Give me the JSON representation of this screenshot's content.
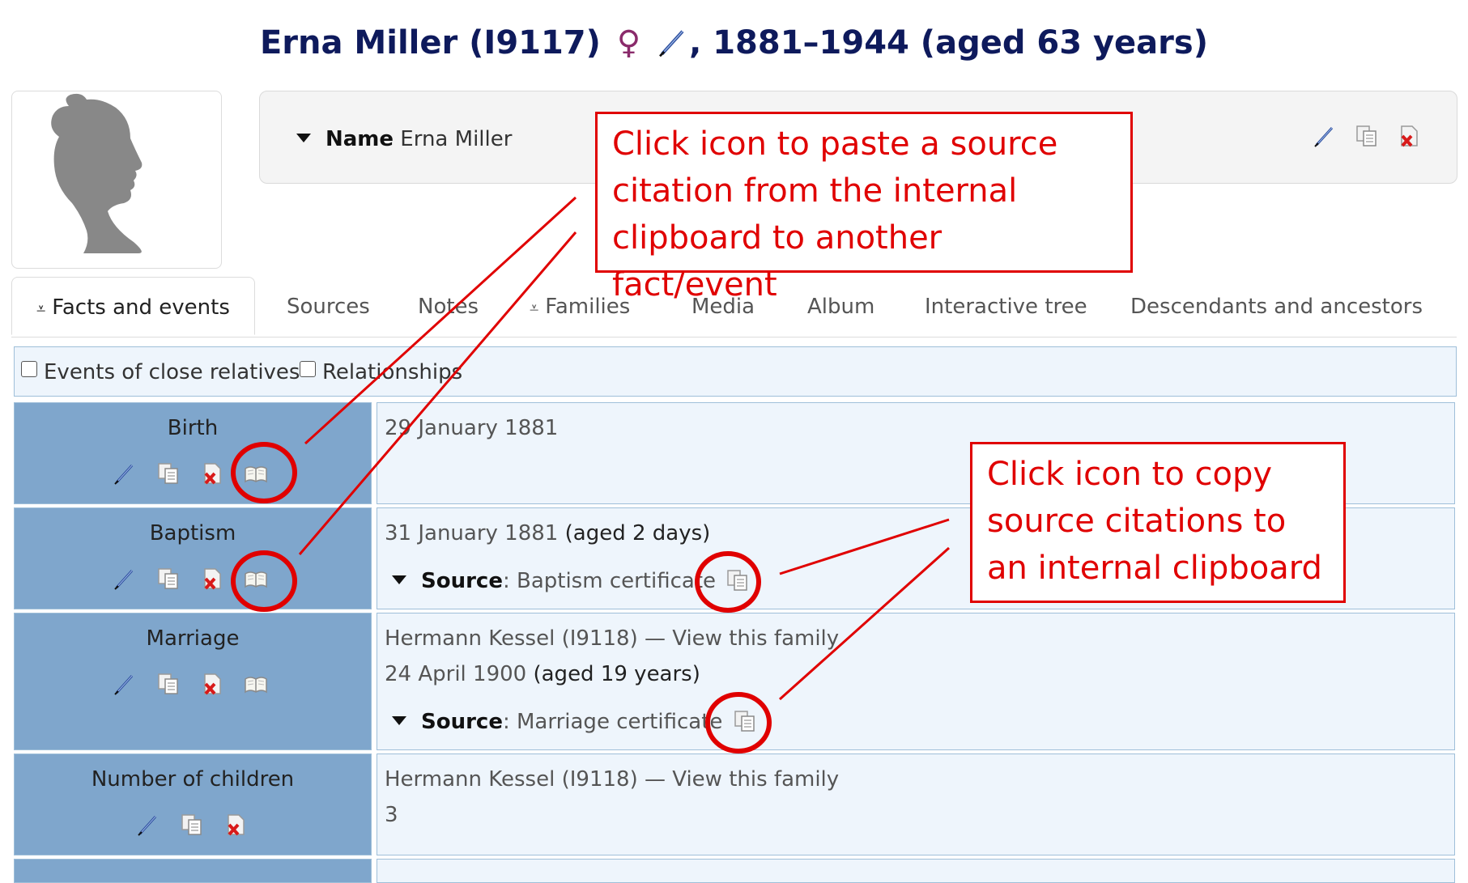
{
  "header": {
    "name": "Erna Miller (I9117)",
    "gender_symbol": "♀",
    "dates": ", 1881–1944 (aged 63 years)"
  },
  "name_card": {
    "label": "Name",
    "value": "Erna Miller"
  },
  "tabs": [
    {
      "label": "Facts and events",
      "active": true
    },
    {
      "label": "Sources"
    },
    {
      "label": "Notes"
    },
    {
      "label": "Families"
    },
    {
      "label": "Media"
    },
    {
      "label": "Album"
    },
    {
      "label": "Interactive tree"
    },
    {
      "label": "Descendants and ancestors"
    }
  ],
  "filters": {
    "close_relatives": "Events of close relatives",
    "relationships": "Relationships"
  },
  "facts": {
    "birth": {
      "label": "Birth",
      "date": "29 January 1881"
    },
    "baptism": {
      "label": "Baptism",
      "date": "31 January 1881",
      "age": "(aged 2 days)",
      "source_label": "Source",
      "source": ": Baptism certificate"
    },
    "marriage": {
      "label": "Marriage",
      "family": "Hermann Kessel (I9118) — View this family",
      "date": "24 April 1900",
      "age": "(aged 19 years)",
      "source_label": "Source",
      "source": ": Marriage certificate"
    },
    "children": {
      "label": "Number of children",
      "family": "Hermann Kessel (I9118) — View this family",
      "value": "3"
    }
  },
  "annotations": {
    "paste": "Click icon to paste a source citation from the internal clipboard to another fact/event",
    "copy": "Click icon to copy source citations to an internal clipboard"
  },
  "colors": {
    "title": "#0e1a5c",
    "label_bg": "#7fa6cc",
    "value_bg": "#eef5fc",
    "annotation": "#e00000"
  }
}
